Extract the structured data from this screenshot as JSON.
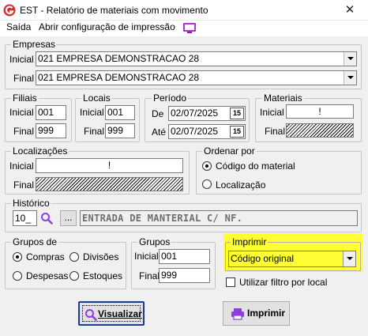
{
  "window": {
    "title": "EST -  Relatório de materiais com movimento",
    "close_glyph": "✕"
  },
  "menu": {
    "exit": "Saída",
    "print_config": "Abrir configuração de impressão"
  },
  "empresas": {
    "legend": "Empresas",
    "initial_label": "Inicial",
    "initial_value": "021 EMPRESA DEMONSTRACAO 28",
    "final_label": "Final",
    "final_value": "021 EMPRESA DEMONSTRACAO 28"
  },
  "filiais": {
    "legend": "Filiais",
    "initial_label": "Inicial",
    "initial_value": "001",
    "final_label": "Final",
    "final_value": "999"
  },
  "locais": {
    "legend": "Locais",
    "initial_label": "Inicial",
    "initial_value": "001",
    "final_label": "Final",
    "final_value": "999"
  },
  "periodo": {
    "legend": "Período",
    "from_label": "De",
    "from_value": "02/07/2025",
    "to_label": "Até",
    "to_value": "02/07/2025",
    "calendar_glyph": "15"
  },
  "materiais": {
    "legend": "Materiais",
    "initial_label": "Inicial",
    "initial_value": "!",
    "final_label": "Final"
  },
  "localizacoes": {
    "legend": "Localizações",
    "initial_label": "Inicial",
    "initial_value": "!",
    "final_label": "Final"
  },
  "ordenar": {
    "legend": "Ordenar por",
    "options": [
      "Código do material",
      "Localização"
    ],
    "selected": 0
  },
  "historico": {
    "legend": "Histórico",
    "code": "10_",
    "ellipsis": "...",
    "description": "ENTRADA DE MANTERIAL C/ NF."
  },
  "grupos_de": {
    "legend": "Grupos de",
    "options": [
      "Compras",
      "Divisões",
      "Despesas",
      "Estoques"
    ],
    "selected": 0
  },
  "grupos": {
    "legend": "Grupos",
    "initial_label": "Inicial",
    "initial_value": "001",
    "final_label": "Final",
    "final_value": "999"
  },
  "imprimir": {
    "legend": "Imprimir",
    "value": "Código original"
  },
  "filter_local": {
    "label": "Utilizar filtro por local",
    "checked": false
  },
  "buttons": {
    "visualizar": "Visualizar",
    "imprimir": "Imprimir"
  },
  "colors": {
    "highlight": "#ffff33",
    "accent": "#1b3c8f",
    "app_icon": "#d32f2f"
  }
}
